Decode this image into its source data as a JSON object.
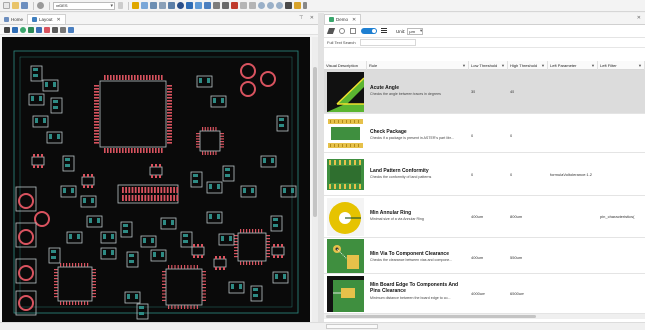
{
  "toolbar": {
    "combo_value": "xrDES"
  },
  "left_panel": {
    "tabs": [
      {
        "label": "Home"
      },
      {
        "label": "Layout"
      }
    ],
    "controls": {
      "pin": "⊤",
      "close": "✕"
    }
  },
  "right_panel": {
    "tab": {
      "label": "Demo"
    },
    "unit_label": "Unit:",
    "unit_value": "μm",
    "search_label": "Full Text Search",
    "columns": [
      {
        "label": "Visual Description"
      },
      {
        "label": "Rule"
      },
      {
        "label": "Low Threshold"
      },
      {
        "label": "High Threshold"
      },
      {
        "label": "Left Parameter"
      },
      {
        "label": "Left Filter"
      }
    ],
    "rules": [
      {
        "title": "Acute Angle",
        "desc": "Checks the angle between traces in degrees",
        "low": "35",
        "high": "45",
        "param": "",
        "filter": ""
      },
      {
        "title": "Check Package",
        "desc": "Checks if a package is present in ASTER's part libr...",
        "low": "0",
        "high": "0",
        "param": "",
        "filter": ""
      },
      {
        "title": "Land Pattern Conformity",
        "desc": "Checks the conformity of land patterns",
        "low": "0",
        "high": "0",
        "param": "formulaVoltolerance:1.2",
        "filter": ""
      },
      {
        "title": "Min Annular Ring",
        "desc": "Minimal size of a via Annular Ring",
        "low": "400um",
        "high": "800um",
        "param": "",
        "filter": "pin_characteristics("
      },
      {
        "title": "Min Via To Component Clearance",
        "desc": "Checks the clearance between vias and compone...",
        "low": "400um",
        "high": "550um",
        "param": "",
        "filter": ""
      },
      {
        "title": "Min Board Edge To Components And Pins Clearance",
        "desc": "Minimum distance between the board edge to co...",
        "low": "4000um",
        "high": "6500um",
        "param": "",
        "filter": ""
      }
    ]
  },
  "colors": {
    "pcb_background": "#0a0a0a",
    "pad_red": "#d9535f",
    "pad_teal": "#2e8b84",
    "silkscreen": "#b8c4c6",
    "highlight_yellow": "#f0e22e",
    "toggle_blue": "#1e7fd1"
  }
}
